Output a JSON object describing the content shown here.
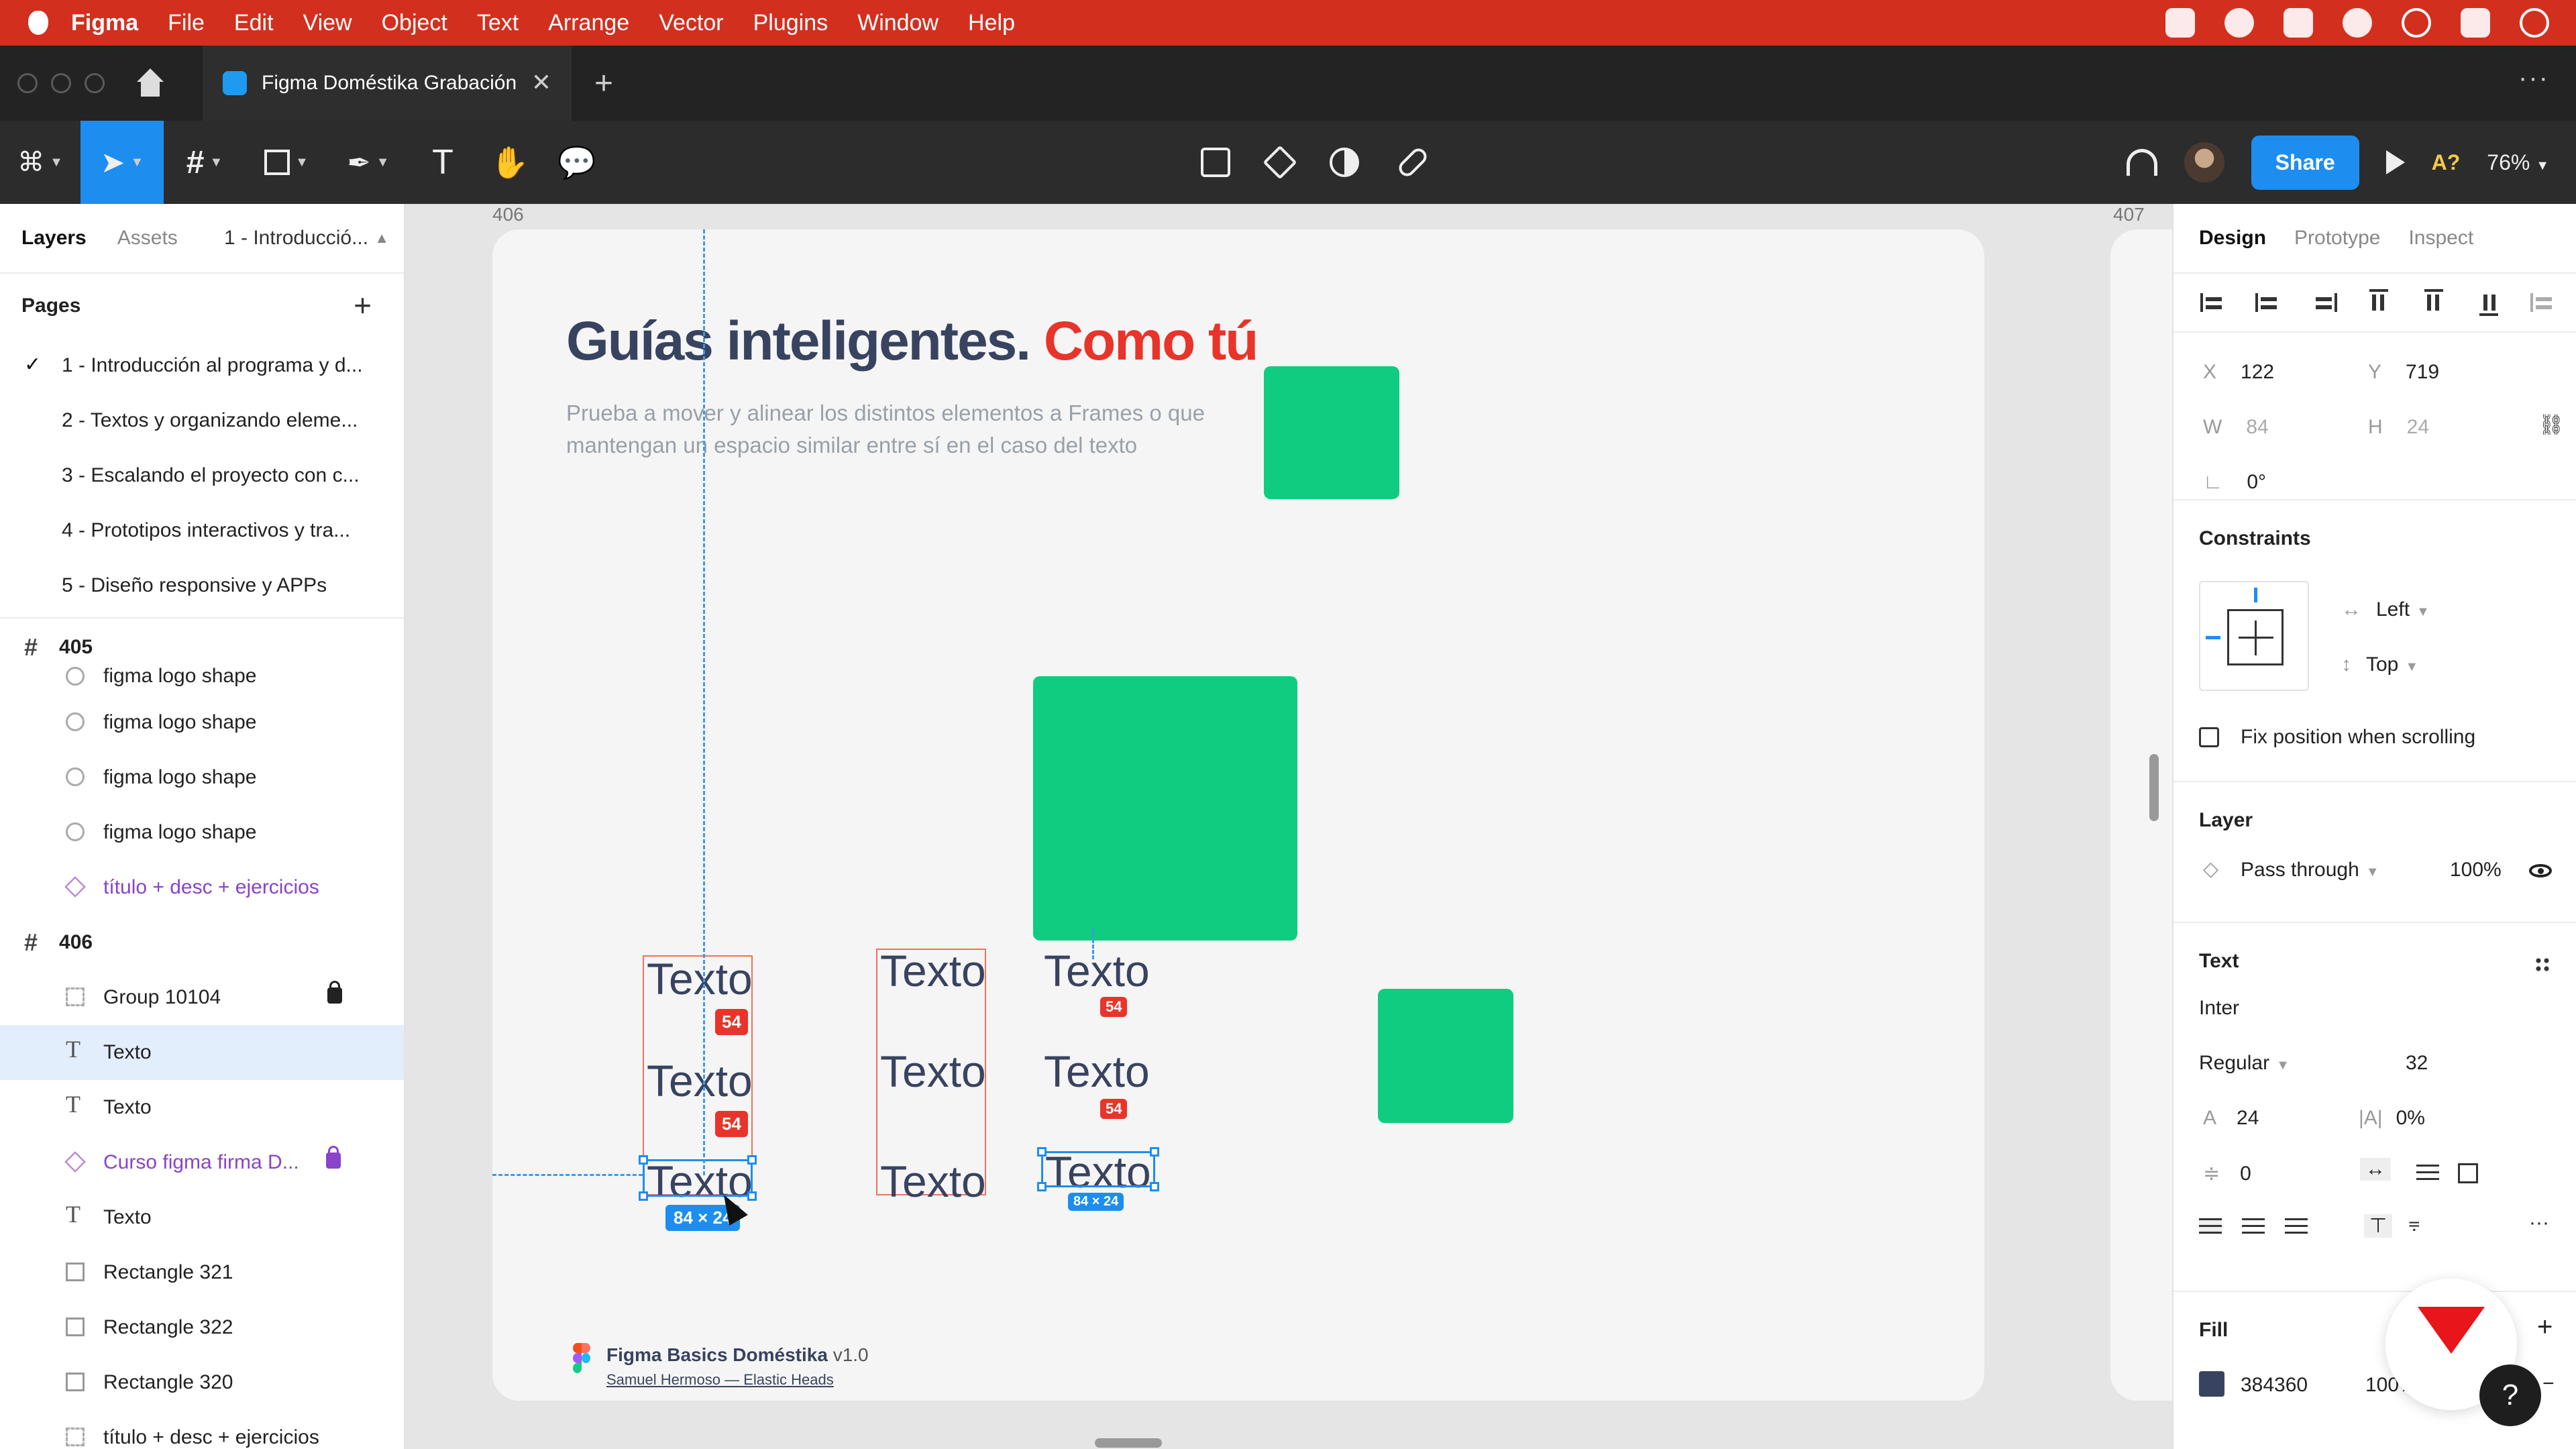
{
  "menubar": {
    "app": "Figma",
    "items": [
      "File",
      "Edit",
      "View",
      "Object",
      "Text",
      "Arrange",
      "Vector",
      "Plugins",
      "Window",
      "Help"
    ]
  },
  "tabbar": {
    "file_tab": "Figma Doméstika Grabación",
    "close": "✕",
    "new_tab": "+",
    "more": "···"
  },
  "toolbar": {
    "share": "Share",
    "accessibility": "A?",
    "zoom": "76%"
  },
  "left_panel": {
    "tabs": [
      "Layers",
      "Assets"
    ],
    "current_page": "1 - Introducció...",
    "pages_title": "Pages",
    "pages": [
      "1 - Introducción al programa y d...",
      "2 - Textos y organizando eleme...",
      "3 - Escalando el proyecto con c...",
      "4 - Prototipos interactivos y tra...",
      "5 - Diseño responsive y APPs"
    ],
    "frame405": "405",
    "frame405_layers": [
      "figma logo shape",
      "figma logo shape",
      "figma logo shape",
      "figma logo shape",
      "título + desc + ejercicios"
    ],
    "frame406": "406",
    "frame406_layers": [
      "Group 10104",
      "Texto",
      "Texto",
      "Curso figma firma D...",
      "Texto",
      "Rectangle 321",
      "Rectangle 322",
      "Rectangle 320",
      "título + desc + ejercicios"
    ]
  },
  "canvas": {
    "frame_label_left": "406",
    "frame_label_right": "407",
    "headline_main": "Guías inteligentes.",
    "headline_accent": "Como tú",
    "subtext": "Prueba a mover y alinear los distintos elementos a Frames o que mantengan un espacio similar entre sí en el caso del texto",
    "texto": "Texto",
    "spacing": "54",
    "selection_size": "84 × 24",
    "footer_title": "Figma Basics Doméstika",
    "footer_version": "v1.0",
    "footer_author": "Samuel Hermoso",
    "footer_sep": "—",
    "footer_company": "Elastic Heads",
    "colors": {
      "green": "#10cc80",
      "headline": "#384360",
      "accent": "#e8342a",
      "selection": "#1d8ef0"
    }
  },
  "right_panel": {
    "tabs": [
      "Design",
      "Prototype",
      "Inspect"
    ],
    "x_label": "X",
    "x": "122",
    "y_label": "Y",
    "y": "719",
    "w_label": "W",
    "w": "84",
    "h_label": "H",
    "h": "24",
    "rotation": "0°",
    "constraints_title": "Constraints",
    "constraint_h": "Left",
    "constraint_v": "Top",
    "fix_position": "Fix position when scrolling",
    "layer_title": "Layer",
    "blend": "Pass through",
    "opacity": "100%",
    "text_title": "Text",
    "font": "Inter",
    "weight": "Regular",
    "size": "32",
    "line_height": "24",
    "letter_spacing": "0%",
    "paragraph_spacing": "0",
    "fill_title": "Fill",
    "fill_hex": "384360",
    "fill_opacity": "100%",
    "help": "?"
  }
}
